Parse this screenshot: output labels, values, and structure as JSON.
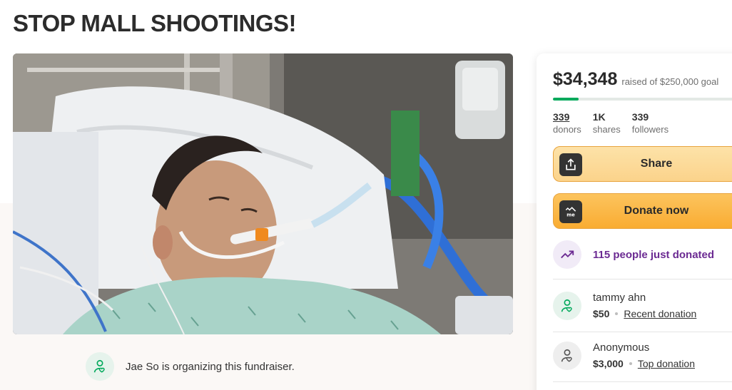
{
  "page": {
    "title": "STOP MALL SHOOTINGS!"
  },
  "hero": {
    "image_semantic": "hospital-patient-photo"
  },
  "organizer": {
    "text": "Jae So is organizing this fundraiser."
  },
  "donation_card": {
    "raised_amount": "$34,348",
    "goal_text": "raised of $250,000 goal",
    "progress_fraction": 0.137,
    "stats": [
      {
        "value": "339",
        "label": "donors"
      },
      {
        "value": "1K",
        "label": "shares"
      },
      {
        "value": "339",
        "label": "followers"
      }
    ],
    "share_label": "Share",
    "donate_label": "Donate now",
    "just_donated_text": "115 people just donated",
    "donations": [
      {
        "name": "tammy ahn",
        "amount": "$50",
        "tag": "Recent donation"
      },
      {
        "name": "Anonymous",
        "amount": "$3,000",
        "tag": "Top donation"
      }
    ]
  },
  "colors": {
    "brand_green": "#02a95c",
    "button_orange": "#f9ac32",
    "accent_purple": "#6b2a92"
  },
  "icons": [
    "share-icon",
    "gofundme-me-icon",
    "trending-up-icon",
    "heart-hand-icon"
  ]
}
